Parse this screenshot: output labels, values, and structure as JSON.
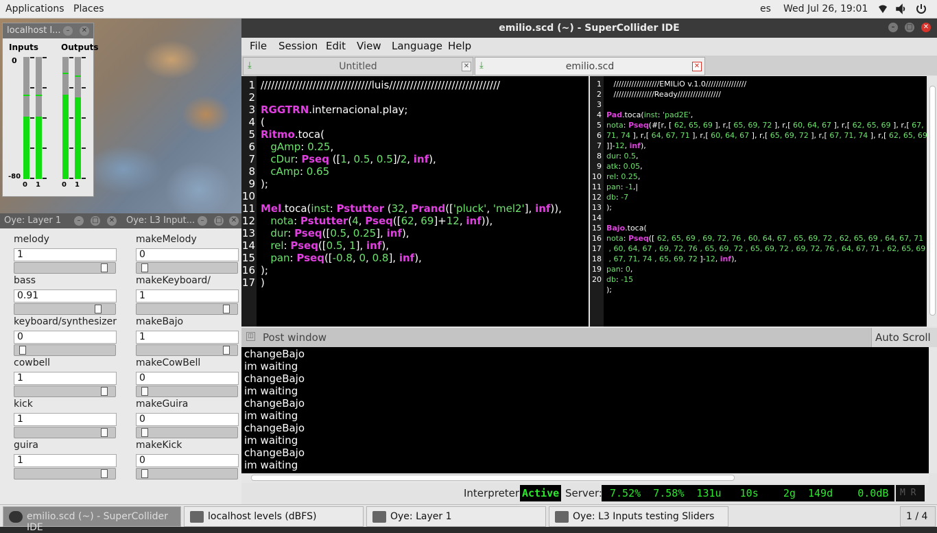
{
  "topbar": {
    "applications": "Applications",
    "places": "Places",
    "lang": "es",
    "clock": "Wed Jul 26, 19:01"
  },
  "levels": {
    "title": "localhost l...",
    "inputs": "Inputs",
    "outputs": "Outputs",
    "top_db": "0",
    "bottom_db": "-80",
    "ch0": "0",
    "ch1": "1",
    "ch0b": "0",
    "ch1b": "1",
    "meter_levels": [
      0.51,
      0.51,
      0.69,
      0.67
    ]
  },
  "oye": {
    "layer1_title": "Oye: Layer 1",
    "l3_title": "Oye: L3 Input...",
    "left": [
      {
        "label": "melody",
        "value": "1",
        "slider": 0.93
      },
      {
        "label": "bass",
        "value": "0.91",
        "slider": 0.86
      },
      {
        "label": "keyboard/synthesizer",
        "value": "0",
        "slider": 0.05
      },
      {
        "label": "cowbell",
        "value": "1",
        "slider": 0.93
      },
      {
        "label": "kick",
        "value": "1",
        "slider": 0.93
      },
      {
        "label": "guira",
        "value": "1",
        "slider": 0.93
      }
    ],
    "right": [
      {
        "label": "makeMelody",
        "value": "0",
        "slider": 0.05
      },
      {
        "label": "makeKeyboard/",
        "value": "1",
        "slider": 0.93
      },
      {
        "label": "makeBajo",
        "value": "1",
        "slider": 0.93
      },
      {
        "label": "makeCowBell",
        "value": "0",
        "slider": 0.05
      },
      {
        "label": "makeGuira",
        "value": "0",
        "slider": 0.05
      },
      {
        "label": "makeKick",
        "value": "0",
        "slider": 0.05
      }
    ]
  },
  "ide": {
    "title": "emilio.scd (~) - SuperCollider IDE",
    "menu": [
      "File",
      "Session",
      "Edit",
      "View",
      "Language",
      "Help"
    ],
    "tabs": [
      "Untitled",
      "emilio.scd"
    ],
    "post_title": "Post window",
    "auto_scroll": "Auto Scroll",
    "post_lines": [
      "changeBajo",
      "im waiting",
      "changeBajo",
      "im waiting",
      "changeBajo",
      "im waiting",
      "changeBajo",
      "im waiting",
      "changeBajo",
      "im waiting"
    ],
    "status": {
      "interpreter_label": "Interpreter:",
      "interpreter_state": "Active",
      "server_label": "Server:",
      "server_stats": "7.52%  7.58%  131u   10s    2g  149d    0.0dB"
    }
  },
  "editor_left": {
    "line_numbers": [
      "1",
      "2",
      "3",
      "4",
      "5",
      "6",
      "7",
      "8",
      "9",
      "10",
      "11",
      "12",
      "13",
      "14",
      "15",
      "16",
      "17"
    ]
  },
  "editor_right": {
    "line_numbers": [
      "1",
      "2",
      "3",
      "4",
      "5",
      "",
      "",
      "6",
      "7",
      "8",
      "9",
      "10",
      "11",
      "12",
      "13",
      "14",
      "",
      "",
      "15",
      "16",
      "17",
      "18",
      "19",
      "20"
    ]
  },
  "taskbar": {
    "items": [
      "emilio.scd (~) - SuperCollider IDE",
      "localhost levels (dBFS)",
      "Oye: Layer 1",
      "Oye: L3 Inputs testing Sliders"
    ],
    "workspace": "1 / 4"
  },
  "colors": {
    "keyword": "#e040e0",
    "number": "#6fe36f",
    "meter": "#11dd11",
    "close_red": "#d9342b"
  }
}
